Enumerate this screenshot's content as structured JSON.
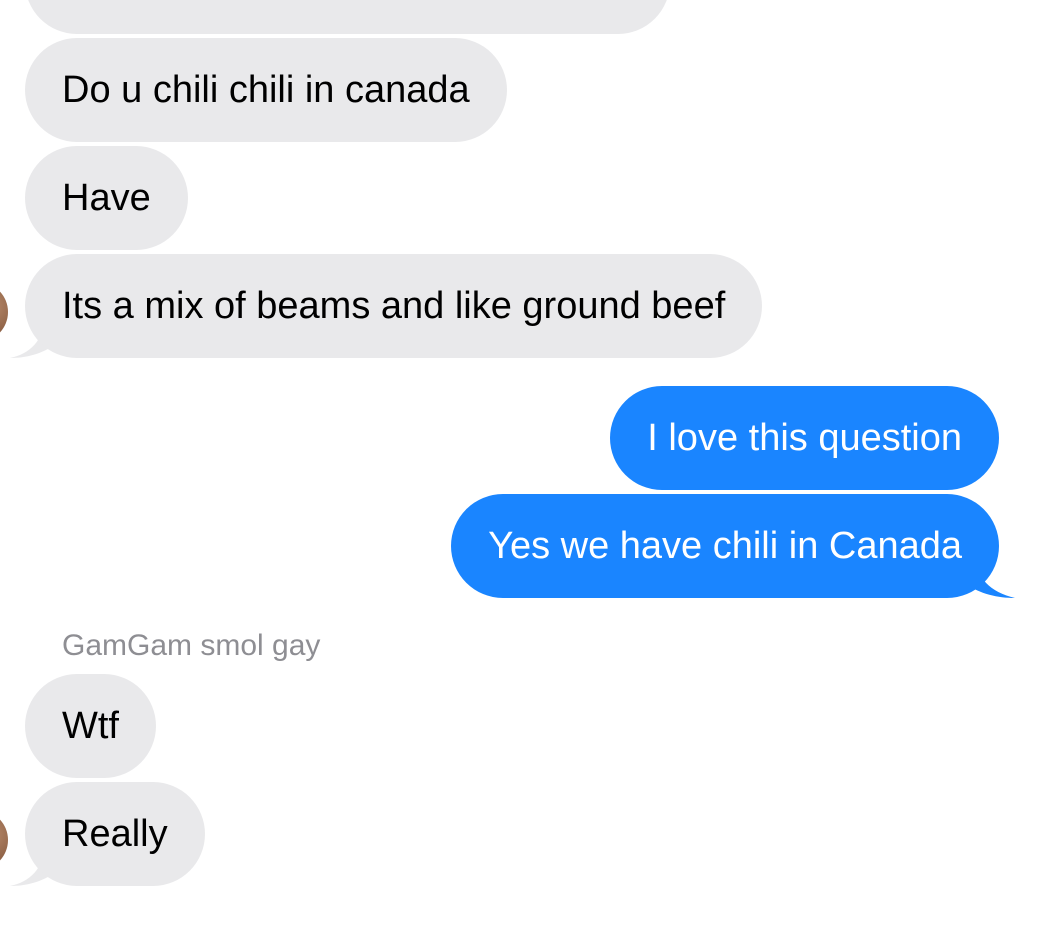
{
  "conversation": {
    "messages": [
      {
        "direction": "incoming",
        "text": ""
      },
      {
        "direction": "incoming",
        "text": "Do u chili chili in canada"
      },
      {
        "direction": "incoming",
        "text": "Have"
      },
      {
        "direction": "incoming",
        "text": "Its a mix of beams and like ground beef"
      },
      {
        "direction": "outgoing",
        "text": "I love this question"
      },
      {
        "direction": "outgoing",
        "text": "Yes we have chili in Canada"
      },
      {
        "direction": "incoming",
        "text": "Wtf"
      },
      {
        "direction": "incoming",
        "text": "Really"
      }
    ],
    "sender_name": "GamGam smol gay"
  },
  "colors": {
    "incoming_bubble": "#e9e9eb",
    "outgoing_bubble": "#1a85ff",
    "incoming_text": "#000000",
    "outgoing_text": "#ffffff",
    "sender_name_text": "#8e8e93"
  }
}
